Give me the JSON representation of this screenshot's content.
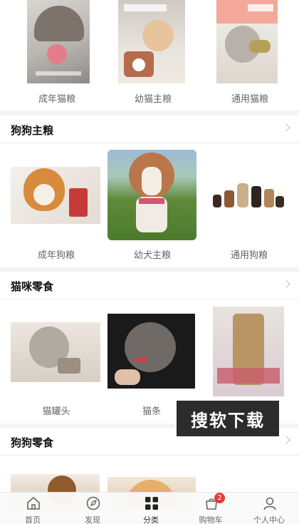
{
  "sections": {
    "cat_food": {
      "items": [
        {
          "label": "成年猫粮"
        },
        {
          "label": "幼猫主粮"
        },
        {
          "label": "通用猫粮"
        }
      ]
    },
    "dog_food": {
      "title": "狗狗主粮",
      "items": [
        {
          "label": "成年狗粮"
        },
        {
          "label": "幼犬主粮"
        },
        {
          "label": "通用狗粮"
        }
      ]
    },
    "cat_snacks": {
      "title": "猫咪零食",
      "items": [
        {
          "label": "猫罐头"
        },
        {
          "label": "猫条"
        },
        {
          "label": ""
        }
      ]
    },
    "dog_snacks": {
      "title": "狗狗零食"
    }
  },
  "watermark": "搜软下载",
  "tabbar": {
    "tabs": [
      {
        "label": "首页",
        "icon": "home-icon"
      },
      {
        "label": "发现",
        "icon": "discover-icon"
      },
      {
        "label": "分类",
        "icon": "category-icon",
        "active": true
      },
      {
        "label": "购物车",
        "icon": "cart-icon",
        "badge": "2"
      },
      {
        "label": "个人中心",
        "icon": "user-icon"
      }
    ]
  },
  "colors": {
    "accent": "#e4393c",
    "promo_pink": "#f3a89a",
    "text": "#333333"
  }
}
